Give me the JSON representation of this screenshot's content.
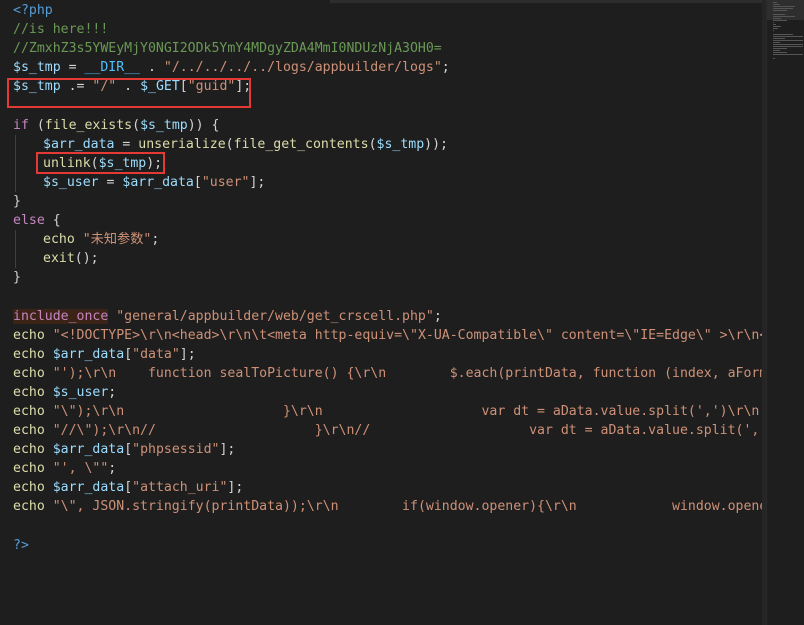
{
  "editor": {
    "lines": [
      [
        {
          "t": "<?php",
          "c": "tag"
        }
      ],
      [
        {
          "t": "//is here!!!",
          "c": "cmt"
        }
      ],
      [
        {
          "t": "//ZmxhZ3s5YWEyMjY0NGI2ODk5YmY4MDgyZDA4MmI0NDUzNjA3OH0=",
          "c": "cmt"
        }
      ],
      [
        {
          "t": "$s_tmp",
          "c": "var"
        },
        {
          "t": " = ",
          "c": "plain"
        },
        {
          "t": "__DIR__",
          "c": "const"
        },
        {
          "t": " . ",
          "c": "plain"
        },
        {
          "t": "\"/../../../../logs/appbuilder/logs\"",
          "c": "str"
        },
        {
          "t": ";",
          "c": "plain"
        }
      ],
      [
        {
          "t": "$s_tmp",
          "c": "var"
        },
        {
          "t": " .= ",
          "c": "plain"
        },
        {
          "t": "\"/\"",
          "c": "str"
        },
        {
          "t": " . ",
          "c": "plain"
        },
        {
          "t": "$_GET",
          "c": "var"
        },
        {
          "t": "[",
          "c": "plain"
        },
        {
          "t": "\"guid\"",
          "c": "str"
        },
        {
          "t": "];",
          "c": "plain"
        }
      ],
      [],
      [
        {
          "t": "if",
          "c": "kw"
        },
        {
          "t": " (",
          "c": "plain"
        },
        {
          "t": "file_exists",
          "c": "fn"
        },
        {
          "t": "(",
          "c": "plain"
        },
        {
          "t": "$s_tmp",
          "c": "var"
        },
        {
          "t": ")) {",
          "c": "plain"
        }
      ],
      [
        {
          "t": "IND"
        },
        {
          "t": "$arr_data",
          "c": "var"
        },
        {
          "t": " = ",
          "c": "plain"
        },
        {
          "t": "unserialize",
          "c": "fn"
        },
        {
          "t": "(",
          "c": "plain"
        },
        {
          "t": "file_get_contents",
          "c": "fn"
        },
        {
          "t": "(",
          "c": "plain"
        },
        {
          "t": "$s_tmp",
          "c": "var"
        },
        {
          "t": "));",
          "c": "plain"
        }
      ],
      [
        {
          "t": "IND"
        },
        {
          "t": "unlink",
          "c": "fn"
        },
        {
          "t": "(",
          "c": "plain"
        },
        {
          "t": "$s_tmp",
          "c": "var"
        },
        {
          "t": ");",
          "c": "plain"
        }
      ],
      [
        {
          "t": "IND"
        },
        {
          "t": "$s_user",
          "c": "var"
        },
        {
          "t": " = ",
          "c": "plain"
        },
        {
          "t": "$arr_data",
          "c": "var"
        },
        {
          "t": "[",
          "c": "plain"
        },
        {
          "t": "\"user\"",
          "c": "str"
        },
        {
          "t": "];",
          "c": "plain"
        }
      ],
      [
        {
          "t": "}",
          "c": "plain"
        }
      ],
      [
        {
          "t": "else",
          "c": "kw"
        },
        {
          "t": " {",
          "c": "plain"
        }
      ],
      [
        {
          "t": "IND"
        },
        {
          "t": "echo",
          "c": "fn"
        },
        {
          "t": " ",
          "c": "plain"
        },
        {
          "t": "\"未知参数\"",
          "c": "str"
        },
        {
          "t": ";",
          "c": "plain"
        }
      ],
      [
        {
          "t": "IND"
        },
        {
          "t": "exit",
          "c": "fn"
        },
        {
          "t": "();",
          "c": "plain"
        }
      ],
      [
        {
          "t": "}",
          "c": "plain"
        }
      ],
      [],
      [
        {
          "t": "include_once",
          "c": "inc"
        },
        {
          "t": " ",
          "c": "plain"
        },
        {
          "t": "\"general/appbuilder/web/get_crscell.php\"",
          "c": "str"
        },
        {
          "t": ";",
          "c": "plain"
        }
      ],
      [
        {
          "t": "echo",
          "c": "fn"
        },
        {
          "t": " ",
          "c": "plain"
        },
        {
          "t": "\"<!DOCTYPE>\\r\\n<head>\\r\\n\\t<meta http-equiv=\\\"X-UA-Compatible\\\" content=\\\"IE=Edge\\\" >\\r\\n</head>",
          "c": "str"
        }
      ],
      [
        {
          "t": "echo",
          "c": "fn"
        },
        {
          "t": " ",
          "c": "plain"
        },
        {
          "t": "$arr_data",
          "c": "var"
        },
        {
          "t": "[",
          "c": "plain"
        },
        {
          "t": "\"data\"",
          "c": "str"
        },
        {
          "t": "];",
          "c": "plain"
        }
      ],
      [
        {
          "t": "echo",
          "c": "fn"
        },
        {
          "t": " ",
          "c": "plain"
        },
        {
          "t": "\"');\\r\\n    function sealToPicture() {\\r\\n        $.each(printData, function (index, aForm) {",
          "c": "str"
        }
      ],
      [
        {
          "t": "echo",
          "c": "fn"
        },
        {
          "t": " ",
          "c": "plain"
        },
        {
          "t": "$s_user",
          "c": "var"
        },
        {
          "t": ";",
          "c": "plain"
        }
      ],
      [
        {
          "t": "echo",
          "c": "fn"
        },
        {
          "t": " ",
          "c": "plain"
        },
        {
          "t": "\"\\\");\\r\\n                    }\\r\\n                    var dt = aData.value.split(',')\\r\\n",
          "c": "str"
        }
      ],
      [
        {
          "t": "echo",
          "c": "fn"
        },
        {
          "t": " ",
          "c": "plain"
        },
        {
          "t": "\"//\\\");\\r\\n//                    }\\r\\n//                    var dt = aData.value.split(',')\\r\\n",
          "c": "str"
        }
      ],
      [
        {
          "t": "echo",
          "c": "fn"
        },
        {
          "t": " ",
          "c": "plain"
        },
        {
          "t": "$arr_data",
          "c": "var"
        },
        {
          "t": "[",
          "c": "plain"
        },
        {
          "t": "\"phpsessid\"",
          "c": "str"
        },
        {
          "t": "];",
          "c": "plain"
        }
      ],
      [
        {
          "t": "echo",
          "c": "fn"
        },
        {
          "t": " ",
          "c": "plain"
        },
        {
          "t": "\"', \\\"\"",
          "c": "str"
        },
        {
          "t": ";",
          "c": "plain"
        }
      ],
      [
        {
          "t": "echo",
          "c": "fn"
        },
        {
          "t": " ",
          "c": "plain"
        },
        {
          "t": "$arr_data",
          "c": "var"
        },
        {
          "t": "[",
          "c": "plain"
        },
        {
          "t": "\"attach_uri\"",
          "c": "str"
        },
        {
          "t": "];",
          "c": "plain"
        }
      ],
      [
        {
          "t": "echo",
          "c": "fn"
        },
        {
          "t": " ",
          "c": "plain"
        },
        {
          "t": "\"\\\", JSON.stringify(printData));\\r\\n        if(window.opener){\\r\\n            window.opener.",
          "c": "str"
        }
      ],
      [],
      [
        {
          "t": "?>",
          "c": "tag"
        }
      ]
    ]
  },
  "colors": {
    "highlight_box": "#e53935",
    "background": "#1e1e1e"
  }
}
